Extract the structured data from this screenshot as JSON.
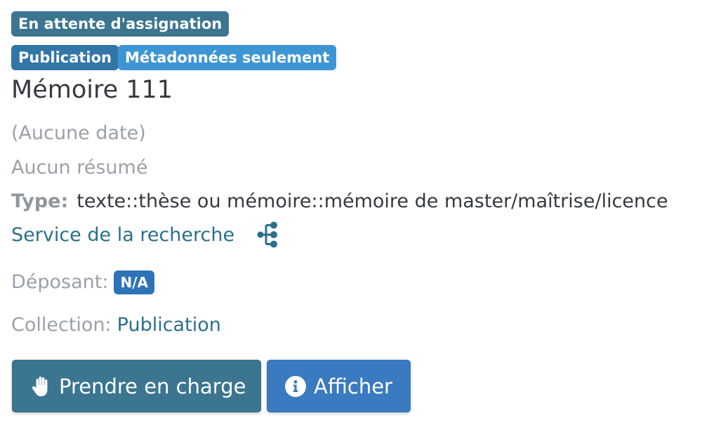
{
  "badges": {
    "status": "En attente d'assignation",
    "category": "Publication",
    "mode": "Métadonnées seulement"
  },
  "item": {
    "title": "Mémoire 111",
    "date": "(Aucune date)",
    "abstract": "Aucun résumé",
    "type_label": "Type:",
    "type_value": "texte::thèse ou mémoire::mémoire de master/maîtrise/licence",
    "service": "Service de la recherche",
    "service_icon": "sitemap-icon",
    "depositor_label": "Déposant:",
    "depositor_value": "N/A",
    "collection_label": "Collection:",
    "collection_value": "Publication"
  },
  "actions": {
    "take_label": "Prendre en charge",
    "take_icon": "hand-icon",
    "view_label": "Afficher",
    "view_icon": "info-circle-icon"
  },
  "colors": {
    "status_badge": "#3b7590",
    "publication_badge": "#3276a8",
    "metadata_badge": "#3d95d4",
    "link": "#2b6f8c",
    "muted_text": "#9aa1a8",
    "take_button": "#3b7590",
    "view_button": "#3a7ac0"
  }
}
